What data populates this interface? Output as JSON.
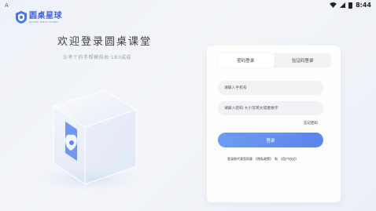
{
  "status_bar": {
    "left_glyph": "A",
    "time": "8:44",
    "icons": [
      "wifi-icon",
      "signal-icon",
      "battery-icon"
    ]
  },
  "logo": {
    "title": "圆桌星球",
    "subtitle": "ROUND TABLE PLANET"
  },
  "hero": {
    "welcome": "欢迎登录圆桌课堂",
    "subtitle": "沙考个的手帮模前由·183成成"
  },
  "login": {
    "tabs": [
      {
        "label": "密码登录",
        "active": true
      },
      {
        "label": "验证码登录",
        "active": false
      }
    ],
    "phone_placeholder": "请输入手机号",
    "password_placeholder": "请输入密码·大小写英文或者数字",
    "forgot_label": "忘记密码",
    "submit_label": "登录",
    "agreement": {
      "prefix": "登录即代表您同意",
      "privacy": "《隐私政策》",
      "and": "和",
      "user": "《用户协议》"
    }
  },
  "colors": {
    "brand": "#3c66e0",
    "button_start": "#6c9cf2",
    "button_end": "#5b86ea",
    "background": "#eef1f7"
  }
}
